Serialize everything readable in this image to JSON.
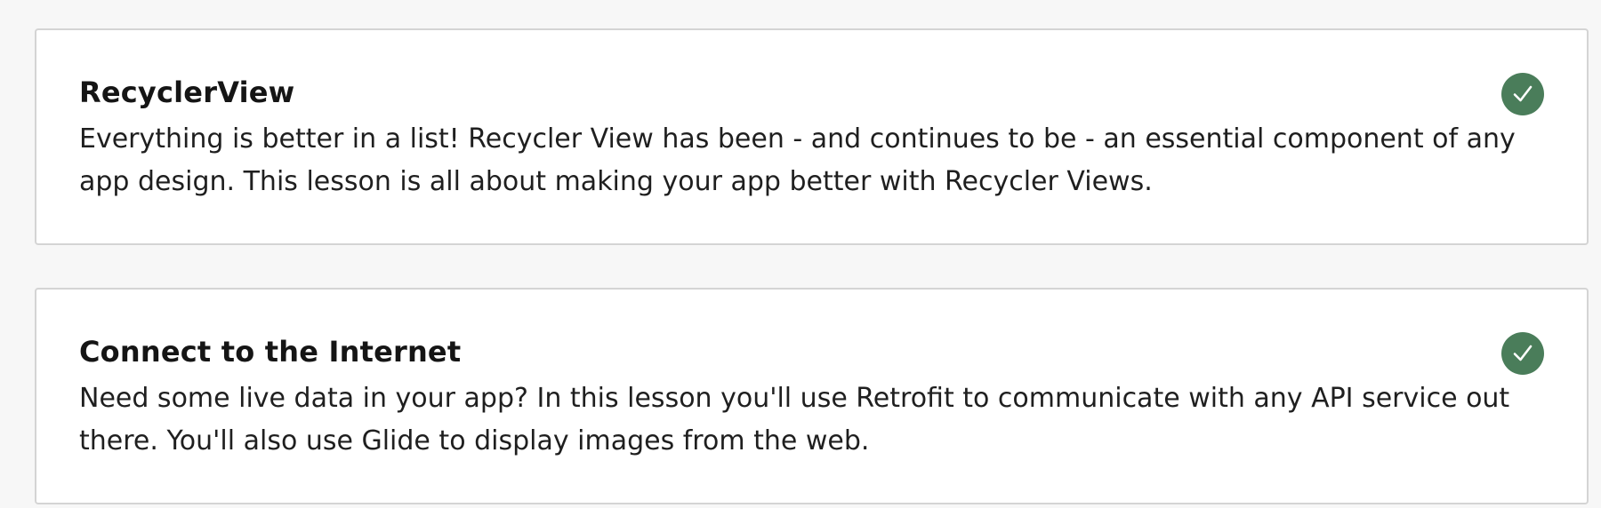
{
  "colors": {
    "background": "#f7f7f7",
    "card_background": "#ffffff",
    "card_border": "#d4d4d4",
    "completed_badge": "#4a7d5a",
    "check_mark": "#ffffff"
  },
  "lessons": [
    {
      "title": "RecyclerView",
      "description": "Everything is better in a list! Recycler View has been - and continues to be - an essential component of any app design. This lesson is all about making your app better with Recycler Views.",
      "status_icon": "check-circle-icon",
      "completed": true
    },
    {
      "title": "Connect to the Internet",
      "description": "Need some live data in your app? In this lesson you'll use Retrofit to communicate with any API service out there. You'll also use Glide to display images from the web.",
      "status_icon": "check-circle-icon",
      "completed": true
    }
  ]
}
